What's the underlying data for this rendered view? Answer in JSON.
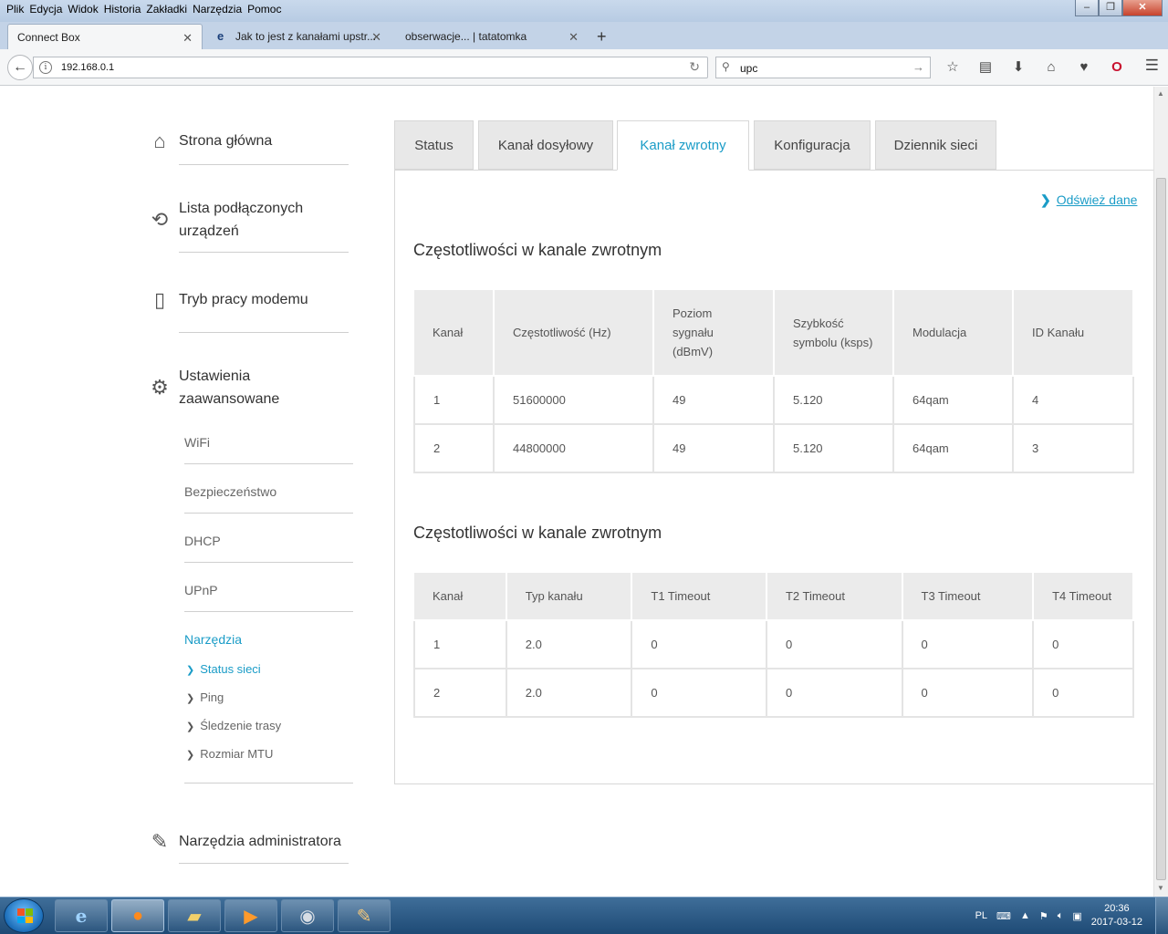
{
  "browser": {
    "menu": [
      "Plik",
      "Edycja",
      "Widok",
      "Historia",
      "Zakładki",
      "Narzędzia",
      "Pomoc"
    ],
    "tabs": [
      {
        "label": "Connect Box"
      },
      {
        "label": "Jak to jest z kanałami upstr..."
      },
      {
        "label": "obserwacje... | tatatomka"
      }
    ],
    "url": "192.168.0.1",
    "search_value": "upc"
  },
  "sidebar": {
    "home": "Strona główna",
    "devices": "Lista podłączonych urządzeń",
    "modem_mode": "Tryb pracy modemu",
    "advanced": "Ustawienia zaawansowane",
    "sub_items": [
      "WiFi",
      "Bezpieczeństwo",
      "DHCP",
      "UPnP",
      "Narzędzia"
    ],
    "tools": [
      "Status sieci",
      "Ping",
      "Śledzenie trasy",
      "Rozmiar MTU"
    ],
    "admin": "Narzędzia administratora"
  },
  "content_tabs": [
    "Status",
    "Kanał dosyłowy",
    "Kanał zwrotny",
    "Konfiguracja",
    "Dziennik sieci"
  ],
  "refresh_label": "Odśwież dane",
  "section1": {
    "title": "Częstotliwości w kanale zwrotnym",
    "headers": [
      "Kanał",
      "Częstotliwość (Hz)",
      "Poziom sygnału (dBmV)",
      "Szybkość symbolu (ksps)",
      "Modulacja",
      "ID Kanału"
    ],
    "rows": [
      [
        "1",
        "51600000",
        "49",
        "5.120",
        "64qam",
        "4"
      ],
      [
        "2",
        "44800000",
        "49",
        "5.120",
        "64qam",
        "3"
      ]
    ]
  },
  "section2": {
    "title": "Częstotliwości w kanale zwrotnym",
    "headers": [
      "Kanał",
      "Typ kanału",
      "T1 Timeout",
      "T2 Timeout",
      "T3 Timeout",
      "T4 Timeout"
    ],
    "rows": [
      [
        "1",
        "2.0",
        "0",
        "0",
        "0",
        "0"
      ],
      [
        "2",
        "2.0",
        "0",
        "0",
        "0",
        "0"
      ]
    ]
  },
  "taskbar": {
    "lang": "PL",
    "time": "20:36",
    "date": "2017-03-12"
  },
  "colors": {
    "accent": "#1a9cc7"
  }
}
